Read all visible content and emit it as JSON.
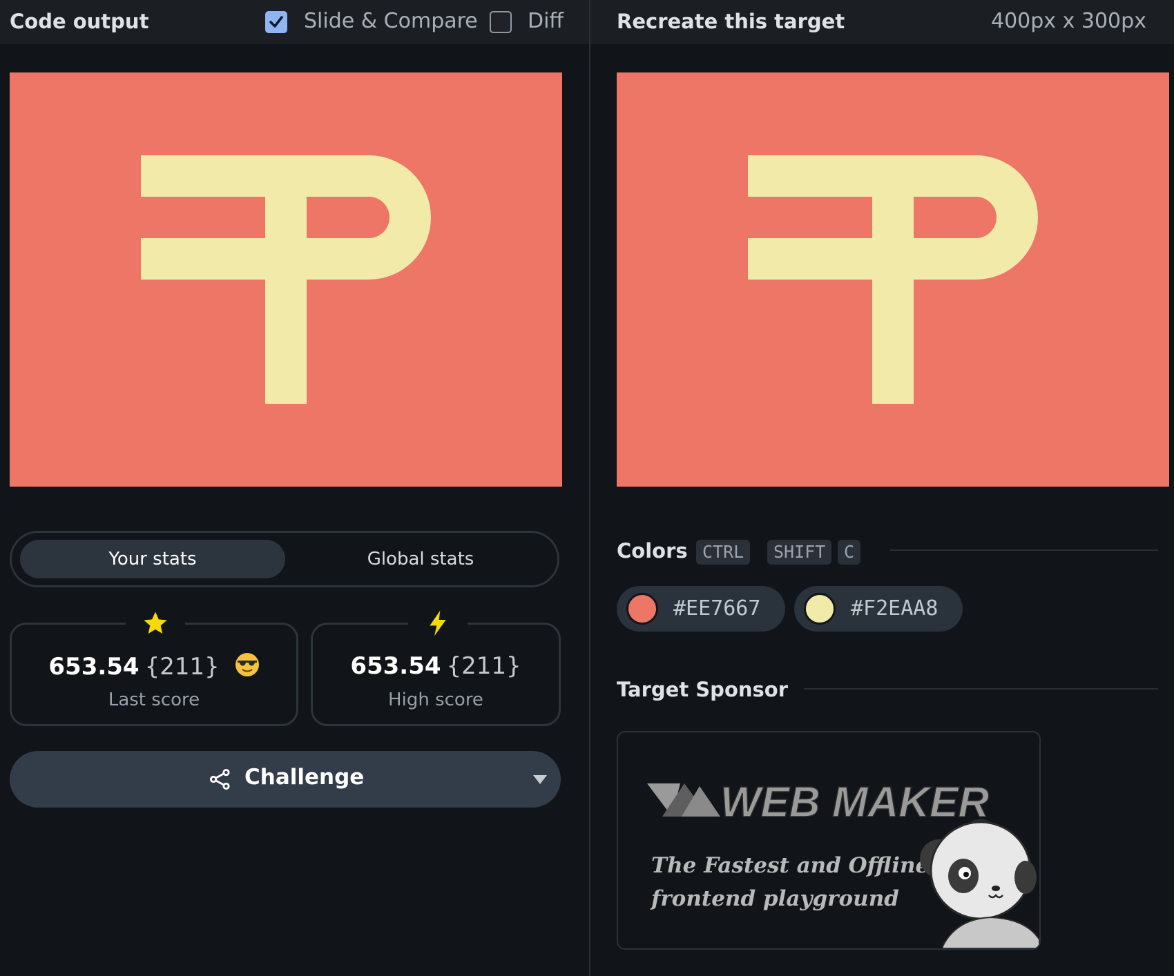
{
  "left": {
    "header": {
      "title": "Code output",
      "slide_compare": {
        "label": "Slide & Compare",
        "checked": true
      },
      "diff": {
        "label": "Diff",
        "checked": false
      }
    },
    "tabs": [
      {
        "label": "Your stats",
        "active": true
      },
      {
        "label": "Global stats",
        "active": false
      }
    ],
    "stats": [
      {
        "icon": "star-icon",
        "score": "653.54",
        "count": "{211}",
        "emoji": "😎",
        "label": "Last score"
      },
      {
        "icon": "lightning-icon",
        "score": "653.54",
        "count": "{211}",
        "label": "High score"
      }
    ],
    "challenge": {
      "label": "Challenge"
    }
  },
  "right": {
    "header": {
      "title": "Recreate this target",
      "size": "400px x 300px"
    },
    "colors": {
      "title": "Colors",
      "shortcut": [
        "CTRL",
        "SHIFT",
        "C"
      ],
      "swatches": [
        "#EE7667",
        "#F2EAA8"
      ]
    },
    "sponsor": {
      "title": "Target Sponsor",
      "brand": "WEB MAKER",
      "tagline_1": "The Fastest and Offline",
      "tagline_2": "frontend playground"
    }
  },
  "design": {
    "background": "#EE7667",
    "foreground": "#F2EAA8"
  }
}
